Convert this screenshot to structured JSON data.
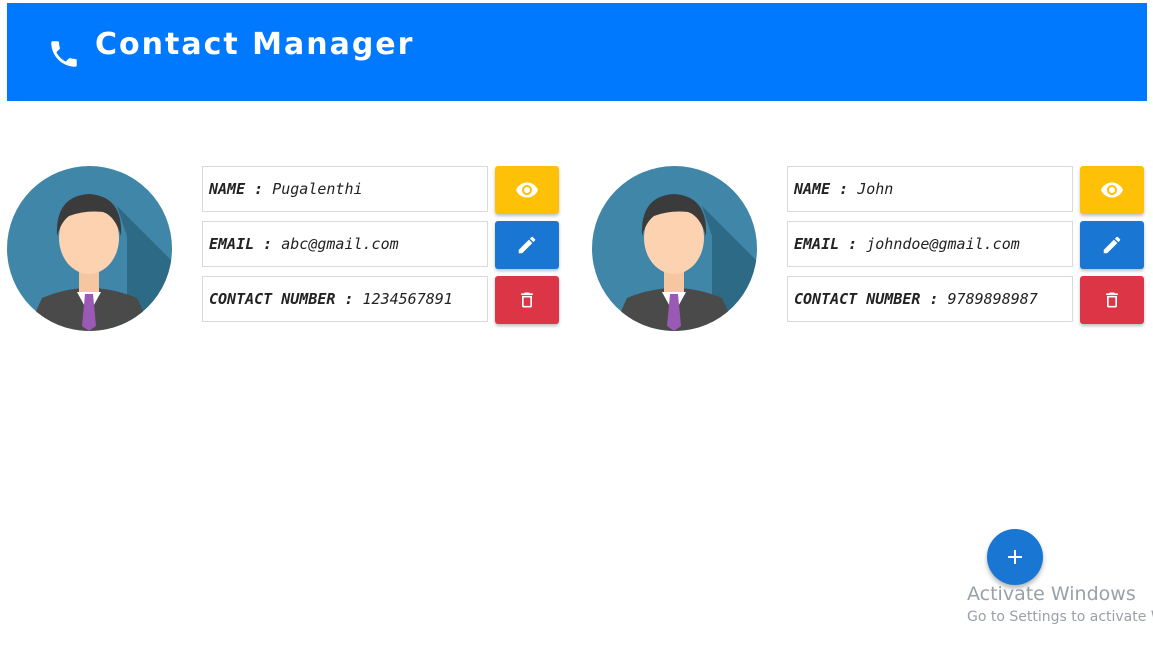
{
  "header": {
    "icon": "phone-icon",
    "title": "Contact Manager",
    "background": "#0079ff"
  },
  "contacts": [
    {
      "avatar": "person-avatar",
      "name_label": "NAME :",
      "name": "Pugalenthi",
      "email_label": "EMAIL :",
      "email": "abc@gmail.com",
      "phone_label": "CONTACT NUMBER :",
      "phone": "1234567891"
    },
    {
      "avatar": "person-avatar",
      "name_label": "NAME :",
      "name": "John",
      "email_label": "EMAIL :",
      "email": "johndoe@gmail.com",
      "phone_label": "CONTACT NUMBER :",
      "phone": "9789898987"
    }
  ],
  "actions": {
    "view_icon": "eye-icon",
    "edit_icon": "pencil-icon",
    "delete_icon": "trash-icon",
    "add_icon": "plus-icon",
    "colors": {
      "view": "#ffc107",
      "edit": "#1976d2",
      "delete": "#dc3545",
      "add": "#1976d2"
    }
  },
  "watermark": {
    "title": "Activate Windows",
    "subtitle": "Go to Settings to activate W"
  }
}
